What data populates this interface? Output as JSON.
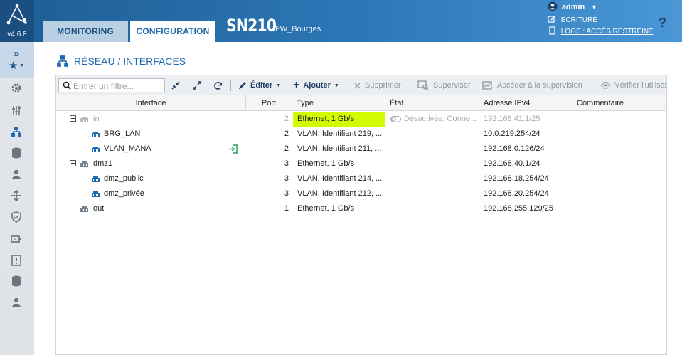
{
  "header": {
    "version": "v4.6.8",
    "tabs": [
      {
        "label": "MONITORING",
        "active": false
      },
      {
        "label": "CONFIGURATION",
        "active": true
      }
    ],
    "model": "SN210",
    "firewall_name": "FW_Bourges",
    "user": "admin",
    "write_link": "ÉCRITURE",
    "logs_link": "LOGS : ACCÈS RESTREINT",
    "help": "?"
  },
  "sidebar": {
    "icons": [
      "expand-icon",
      "favorites-star-icon",
      "settings-gear-icon",
      "sliders-icon",
      "network-icon",
      "database-icon",
      "user-icon",
      "routing-icon",
      "shield-icon",
      "vpn-icon",
      "alert-icon",
      "database2-icon",
      "user2-icon"
    ]
  },
  "page": {
    "title": "RÉSEAU / INTERFACES"
  },
  "toolbar": {
    "search_placeholder": "Entrer un filtre...",
    "edit_label": "Éditer",
    "add_label": "Ajouter",
    "delete_label": "Supprimer",
    "supervise_label": "Superviser",
    "access_supervision_label": "Accéder à la supervision",
    "check_usage_label": "Vérifier l'utilisat"
  },
  "table": {
    "columns": [
      "Interface",
      "Port",
      "Type",
      "État",
      "Adresse IPv4",
      "Commentaire"
    ],
    "rows": [
      {
        "interface": "in",
        "port": "2",
        "type": "Ethernet, 1 Gb/s",
        "etat": "Désactivée, Conne...",
        "ipv4": "192.168.41.1/25",
        "comment": "",
        "level": 0,
        "expanded": true,
        "disabled": true,
        "highlight_type": true
      },
      {
        "interface": "BRG_LAN",
        "port": "2",
        "type": "VLAN, Identifiant 219, ...",
        "etat": "",
        "ipv4": "10.0.219.254/24",
        "comment": "",
        "level": 1
      },
      {
        "interface": "VLAN_MANA",
        "port": "2",
        "type": "VLAN, Identifiant 211, ...",
        "etat": "",
        "ipv4": "192.168.0.126/24",
        "comment": "",
        "level": 1,
        "has_login_icon": true
      },
      {
        "interface": "dmz1",
        "port": "3",
        "type": "Ethernet, 1 Gb/s",
        "etat": "",
        "ipv4": "192.168.40.1/24",
        "comment": "",
        "level": 0,
        "expanded": true
      },
      {
        "interface": "dmz_public",
        "port": "3",
        "type": "VLAN, Identifiant 214, ...",
        "etat": "",
        "ipv4": "192.168.18.254/24",
        "comment": "",
        "level": 1
      },
      {
        "interface": "dmz_privée",
        "port": "3",
        "type": "VLAN, Identifiant 212, ...",
        "etat": "",
        "ipv4": "192.168.20.254/24",
        "comment": "",
        "level": 1
      },
      {
        "interface": "out",
        "port": "1",
        "type": "Ethernet, 1 Gb/s",
        "etat": "",
        "ipv4": "192.168.255.129/25",
        "comment": "",
        "level": 0
      }
    ]
  },
  "colors": {
    "brand_blue": "#1f6bb0",
    "highlight": "#d4fa00",
    "link_green": "#2a9d54"
  }
}
